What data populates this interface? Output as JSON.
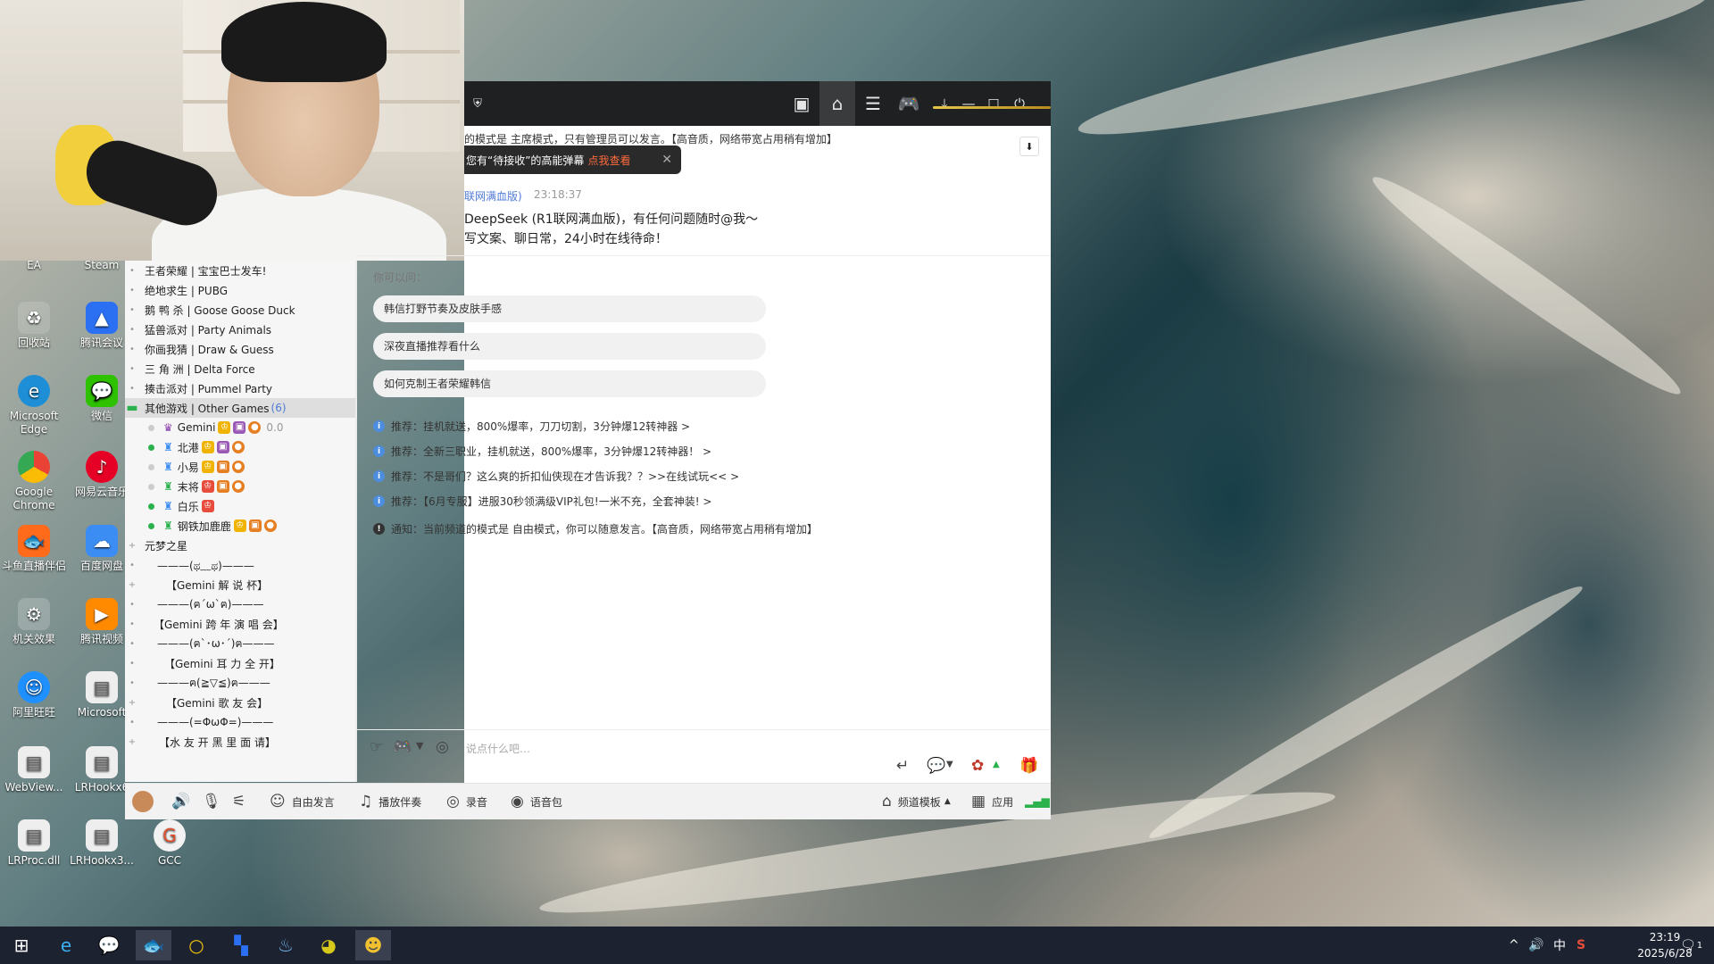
{
  "desktop": {
    "icons": [
      {
        "label": "EA"
      },
      {
        "label": "Steam"
      },
      {
        "label": "回收站"
      },
      {
        "label": "腾讯会议"
      },
      {
        "label": "Microsoft Edge"
      },
      {
        "label": "微信"
      },
      {
        "label": "Google Chrome"
      },
      {
        "label": "网易云音乐"
      },
      {
        "label": "斗鱼直播伴侣"
      },
      {
        "label": "百度网盘"
      },
      {
        "label": "机关效果"
      },
      {
        "label": "腾讯视频"
      },
      {
        "label": "阿里旺旺"
      },
      {
        "label": "Microsoft"
      },
      {
        "label": "WebView..."
      },
      {
        "label": "LRHookx6"
      },
      {
        "label": "LRProc.dll"
      },
      {
        "label": "LRHookx3..."
      },
      {
        "label": "GCC"
      }
    ]
  },
  "chat": {
    "notice_bar": "的模式是 主席模式，只有管理员可以发言。【高音质，网络带宽占用稍有增加】",
    "toast": {
      "text": "您有“待接收”的高能弹幕",
      "link": "点我查看"
    },
    "bot_name": "联网满血版)",
    "bot_time": "23:18:37",
    "bot_line1": "DeepSeek (R1联网满血版)，有任何问题随时@我～",
    "bot_line2": "写文案、聊日常，24小时在线待命！",
    "ask_label": "你可以问：",
    "suggestions": [
      "韩信打野节奏及皮肤手感",
      "深夜直播推荐看什么",
      "如何克制王者荣耀韩信"
    ],
    "recs": [
      "推荐：挂机就送，800%爆率，刀刀切割，3分钟爆12转神器 >",
      "推荐：全新三职业，挂机就送，800%爆率，3分钟爆12转神器！ >",
      "推荐：不是哥们？这么爽的折扣仙侠现在才告诉我？？>>在线试玩<< >",
      "推荐：【6月专服】进服30秒领满级VIP礼包!一米不充，全套神装! >"
    ],
    "notice": "通知：当前频道的模式是 自由模式，你可以随意发言。【高音质，网络带宽占用稍有增加】",
    "input_placeholder": "说点什么吧…"
  },
  "tree": {
    "rows": [
      "王者荣耀 | 宝宝巴士发车!",
      "绝地求生 | PUBG",
      "鹅 鸭 杀 | Goose Goose Duck",
      "猛兽派对 | Party Animals",
      "你画我猜 | Draw & Guess",
      "三 角 洲 | Delta Force",
      "揍击派对 | Pummel Party"
    ],
    "selected": {
      "label": "其他游戏 | Other Games",
      "count": "(6)"
    },
    "members": [
      {
        "name": "Gemini",
        "extra": "0.0"
      },
      {
        "name": "北港"
      },
      {
        "name": "小易"
      },
      {
        "name": "末将"
      },
      {
        "name": "白乐"
      },
      {
        "name": "钢铁加鹿鹿"
      }
    ],
    "after": [
      "元梦之星",
      "———(ಥ﹏ಥ)———",
      "【Gemini 解 说 杯】",
      "———(ฅ´ω`ฅ)———",
      "【Gemini 跨 年 演 唱 会】",
      "———(ฅ`･ω･´)ฅ———",
      "【Gemini 耳 力 全 开】",
      "———ฅ(≧▽≦)ฅ———",
      "【Gemini 歌 友 会】",
      "———(=ΦωΦ=)———",
      "【水 友 开 黑 里 面 请】"
    ]
  },
  "toolbar": {
    "free_speech": "自由发言",
    "play_accompany": "播放伴奏",
    "record": "录音",
    "voice_pack": "语音包",
    "channel_template": "频道模板",
    "apps": "应用"
  },
  "clock": {
    "time": "23:19",
    "date": "2025/6/28"
  },
  "tray": {
    "ime": "中",
    "notif_count": "1"
  }
}
